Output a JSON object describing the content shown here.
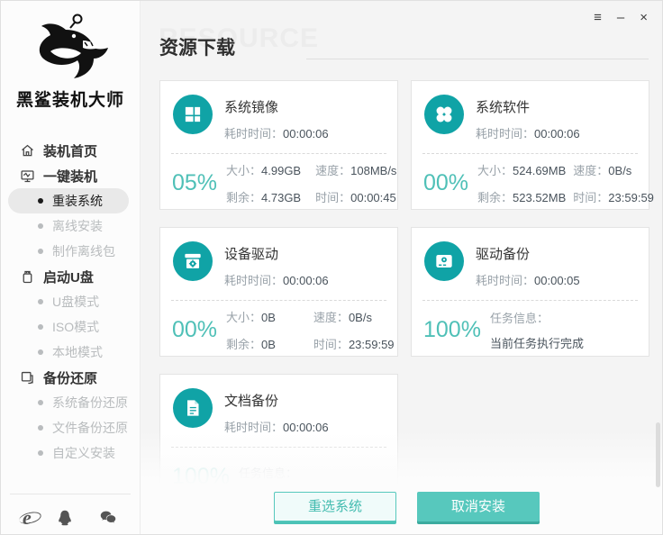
{
  "app": {
    "title": "黑鲨装机大师"
  },
  "window_controls": {
    "menu": "≡",
    "minimize": "–",
    "close": "×"
  },
  "sidebar": {
    "items": [
      {
        "label": "装机首页",
        "level": "top",
        "icon": "home-icon"
      },
      {
        "label": "一键装机",
        "level": "top",
        "icon": "one-click-icon"
      },
      {
        "label": "重装系统",
        "level": "sub",
        "active": true
      },
      {
        "label": "离线安装",
        "level": "sub"
      },
      {
        "label": "制作离线包",
        "level": "sub"
      },
      {
        "label": "启动U盘",
        "level": "top",
        "icon": "usb-icon"
      },
      {
        "label": "U盘模式",
        "level": "sub"
      },
      {
        "label": "ISO模式",
        "level": "sub"
      },
      {
        "label": "本地模式",
        "level": "sub"
      },
      {
        "label": "备份还原",
        "level": "top",
        "icon": "backup-icon"
      },
      {
        "label": "系统备份还原",
        "level": "sub"
      },
      {
        "label": "文件备份还原",
        "level": "sub"
      },
      {
        "label": "自定义安装",
        "level": "sub"
      }
    ],
    "footer_icons": [
      "ie-icon",
      "qq-icon",
      "wechat-icon"
    ]
  },
  "header": {
    "title": "资源下载",
    "watermark": "RESOURCE"
  },
  "labels": {
    "elapsed": "耗时时间：",
    "size": "大小：",
    "speed": "速度：",
    "remain": "剩余：",
    "time": "时间：",
    "task": "任务信息："
  },
  "cards": [
    {
      "title": "系统镜像",
      "icon": "windows-icon",
      "elapsed": "00:00:06",
      "percent": "05%",
      "size": "4.99GB",
      "speed": "108MB/s",
      "remain": "4.73GB",
      "time": "00:00:45"
    },
    {
      "title": "系统软件",
      "icon": "apps-icon",
      "elapsed": "00:00:06",
      "percent": "00%",
      "size": "524.69MB",
      "speed": "0B/s",
      "remain": "523.52MB",
      "time": "23:59:59"
    },
    {
      "title": "设备驱动",
      "icon": "driver-box-icon",
      "elapsed": "00:00:06",
      "percent": "00%",
      "size": "0B",
      "speed": "0B/s",
      "remain": "0B",
      "time": "23:59:59"
    },
    {
      "title": "驱动备份",
      "icon": "hard-drive-icon",
      "elapsed": "00:00:05",
      "percent": "100%",
      "task_status": "当前任务执行完成"
    },
    {
      "title": "文档备份",
      "icon": "document-icon",
      "elapsed": "00:00:06",
      "percent": "100%",
      "task_status": ""
    }
  ],
  "buttons": {
    "reselect": "重选系统",
    "cancel": "取消安装"
  },
  "colors": {
    "accent": "#10a3a6",
    "percent_text": "#4fc0b7",
    "button": "#57c8bd",
    "button_shadow": "#3cab9f"
  }
}
